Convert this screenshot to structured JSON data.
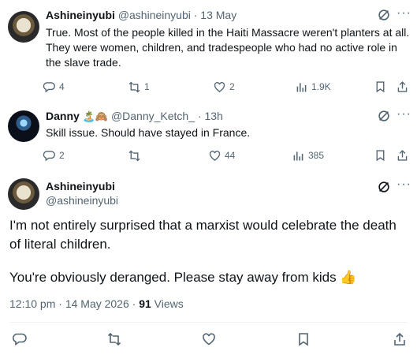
{
  "replies": [
    {
      "name": "Ashineinyubi",
      "handle": "@ashineinyubi",
      "time": "· 13 May",
      "text": "True. Most of the people killed in the Haiti Massacre weren't planters at all. They were women, children, and tradespeople who had no active role in the slave trade.",
      "replies": "4",
      "reposts": "1",
      "likes": "2",
      "views": "1.9K"
    },
    {
      "name": "Danny",
      "emoji": "🏝️🙈",
      "handle": "@Danny_Ketch_",
      "time": "· 13h",
      "text": "Skill issue. Should have stayed in France.",
      "replies": "2",
      "reposts": "",
      "likes": "44",
      "views": "385"
    }
  ],
  "main": {
    "name": "Ashineinyubi",
    "handle": "@ashineinyubi",
    "para1": "I'm not entirely surprised that a marxist would celebrate the death of literal children.",
    "para2": "You're obviously deranged. Please stay away from kids 👍",
    "timestamp": "12:10 pm · 14 May 2026 · ",
    "views_count": "91",
    "views_label": " Views"
  },
  "colors": {
    "text": "#0f1419",
    "muted": "#536471",
    "divider": "#eff3f4"
  },
  "icons": [
    "grok-icon",
    "more-icon",
    "reply-icon",
    "repost-icon",
    "like-icon",
    "views-icon",
    "bookmark-icon",
    "share-icon"
  ]
}
